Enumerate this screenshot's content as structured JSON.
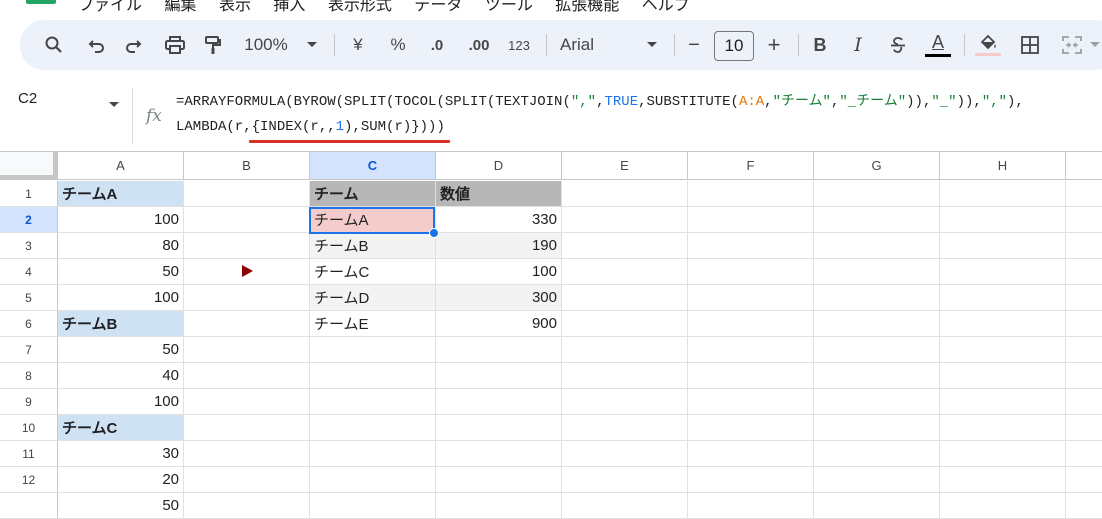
{
  "menu": {
    "items": [
      "ファイル",
      "編集",
      "表示",
      "挿入",
      "表示形式",
      "データ",
      "ツール",
      "拡張機能",
      "ヘルプ"
    ]
  },
  "toolbar": {
    "zoom": "100%",
    "currency": "¥",
    "percent": "%",
    "decrease_decimal": ".0",
    "increase_decimal": ".00",
    "number_format": "123",
    "font": "Arial",
    "minus": "−",
    "font_size": "10",
    "plus": "+",
    "bold": "B",
    "italic": "I",
    "text_color": "A",
    "icons": [
      "search-icon",
      "undo-icon",
      "redo-icon",
      "print-icon",
      "paint-format-icon",
      "zoom-dropdown",
      "font-dropdown",
      "strikethrough-icon",
      "fill-color-icon",
      "borders-icon",
      "merge-cells-icon"
    ]
  },
  "formula_bar": {
    "cell_ref": "C2",
    "fx": "fx",
    "line1": {
      "p1": "=ARRAYFORMULA(BYROW(SPLIT(TOCOL(SPLIT(TEXTJOIN(",
      "s1": "\",\"",
      "p2": ",",
      "b1": "TRUE",
      "p3": ",SUBSTITUTE(",
      "r1": "A:A",
      "p4": ",",
      "s2": "\"チーム\"",
      "p5": ",",
      "s3": "\"_チーム\"",
      "p6": ")),",
      "s4": "\"_\"",
      "p7": ")),",
      "s5": "\",\"",
      "p8": "),"
    },
    "line2": {
      "p1": "LAMBDA(r,{INDEX(r,,",
      "n1": "1",
      "p2": "),SUM(r)})))"
    }
  },
  "grid": {
    "columns": [
      "A",
      "B",
      "C",
      "D",
      "E",
      "F",
      "G",
      "H"
    ],
    "rows": [
      "1",
      "2",
      "3",
      "4",
      "5",
      "6",
      "7",
      "8",
      "9",
      "10",
      "11",
      "12"
    ],
    "selected_column": "C",
    "selected_row": "2",
    "colA": [
      "チームA",
      "100",
      "80",
      "50",
      "100",
      "チームB",
      "50",
      "40",
      "100",
      "チームC",
      "30",
      "20"
    ],
    "result_header": [
      "チーム",
      "数値"
    ],
    "result": [
      [
        "チームA",
        "330"
      ],
      [
        "チームB",
        "190"
      ],
      [
        "チームC",
        "100"
      ],
      [
        "チームD",
        "300"
      ],
      [
        "チームE",
        "900"
      ]
    ],
    "partial_row13_A": "50"
  },
  "colors": {
    "header_blue": "#cfe2f3",
    "header_gray": "#b7b7b7",
    "selected_pink": "#f4cccc",
    "selection_border": "#1a73e8",
    "annotation_red": "#d93025",
    "marker_dark_red": "#8b0000"
  }
}
